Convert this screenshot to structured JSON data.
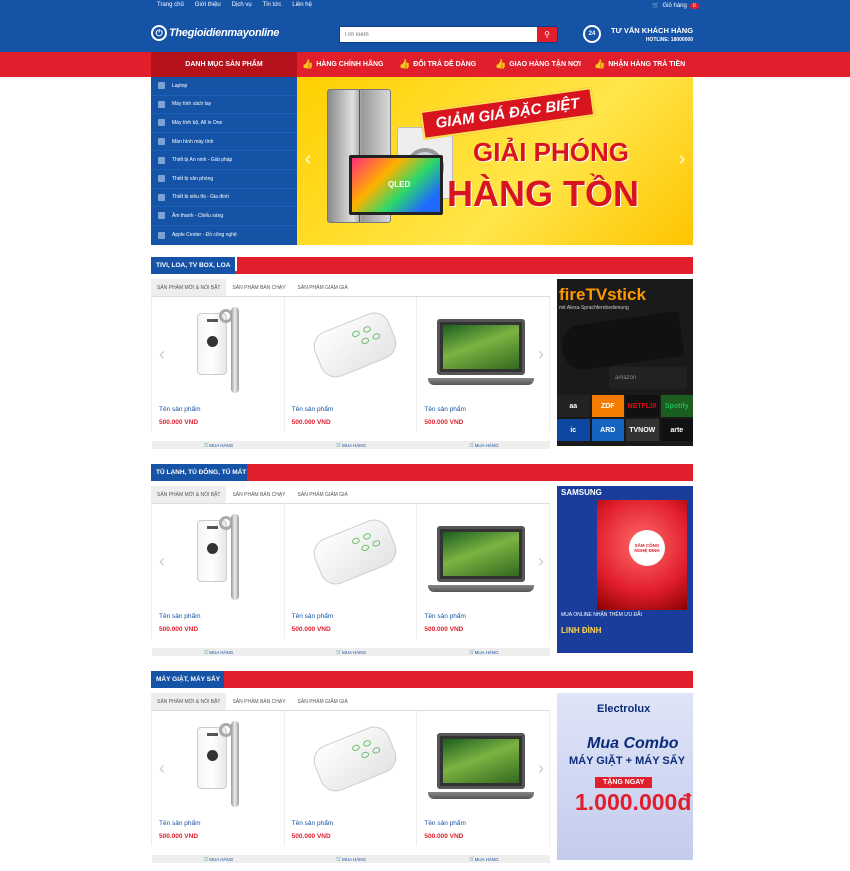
{
  "topbar": {
    "links": [
      "Trang chủ",
      "Giới thiệu",
      "Dịch vụ",
      "Tin tức",
      "Liên hệ"
    ],
    "cart_label": "Giỏ hàng",
    "cart_count": "0"
  },
  "header": {
    "logo_text": "Thegioidienmayonline",
    "search_placeholder": "Tìm kiếm",
    "support_title": "TƯ VẤN KHÁCH HÀNG",
    "hotline": "HOTLINE: 18000000",
    "support_badge": "24"
  },
  "nav": {
    "category_button": "DANH MỤC SẢN PHẨM",
    "features": [
      "HÀNG CHÍNH HÃNG",
      "ĐỔI TRẢ DỄ DÀNG",
      "GIAO HÀNG TẬN NƠI",
      "NHẬN HÀNG TRẢ TIỀN"
    ]
  },
  "sidebar": {
    "items": [
      "Laptop",
      "Máy tính xách tay",
      "Máy tính bộ, All in One",
      "Màn hình máy tính",
      "Thiết bị An ninh - Giải pháp",
      "Thiết bị văn phòng",
      "Thiết bị siêu thị - Gia đình",
      "Âm thanh - Chiếu sáng",
      "Apple Center - Đồ công nghệ"
    ]
  },
  "banner": {
    "line1": "GIẢM GIÁ ĐẶC BIỆT",
    "line2": "GIẢI PHÓNG",
    "line3": "HÀNG TỒN",
    "tv_label": "QLED"
  },
  "tabs": [
    "SẢN PHẨM MỚI & NỔI BẬT",
    "SẢN PHẨM BÁN CHẠY",
    "SẢN PHẨM GIẢM GIÁ"
  ],
  "product": {
    "name": "Tên sản phẩm",
    "price": "500.000 VND",
    "buy": "MUA HÀNG"
  },
  "sections": [
    {
      "title": "TIVI, LOA, TV BOX, LOA"
    },
    {
      "title": "TỦ LẠNH, TỦ ĐÔNG, TỦ MÁT"
    },
    {
      "title": "MÁY GIẶT, MÁY SẤY"
    }
  ],
  "ads": {
    "fire": {
      "title": "fireTVstick",
      "subtitle": "mit Alexa-Sprachfernbedienung",
      "stick": "amazon",
      "logos": [
        "aa",
        "ZDF",
        "NETFLIX",
        "Spotify",
        "ic",
        "ARD",
        "TVNOW",
        "arte"
      ]
    },
    "samsung": {
      "title": "SAMSUNG",
      "circle": "SẮM CÔNG NGHỆ ĐỈNH",
      "text1": "MUA ONLINE NHẬN THÊM ƯU ĐÃI",
      "text2": "LINH ĐÌNH"
    },
    "electrolux": {
      "title": "Electrolux",
      "line1": "Mua Combo",
      "line2": "MÁY GIẶT + MÁY SẤY",
      "line3": "TẶNG NGAY",
      "line4": "1.000.000đ"
    }
  },
  "colors": {
    "brand_blue": "#1553a6",
    "brand_red": "#e11e2b"
  }
}
